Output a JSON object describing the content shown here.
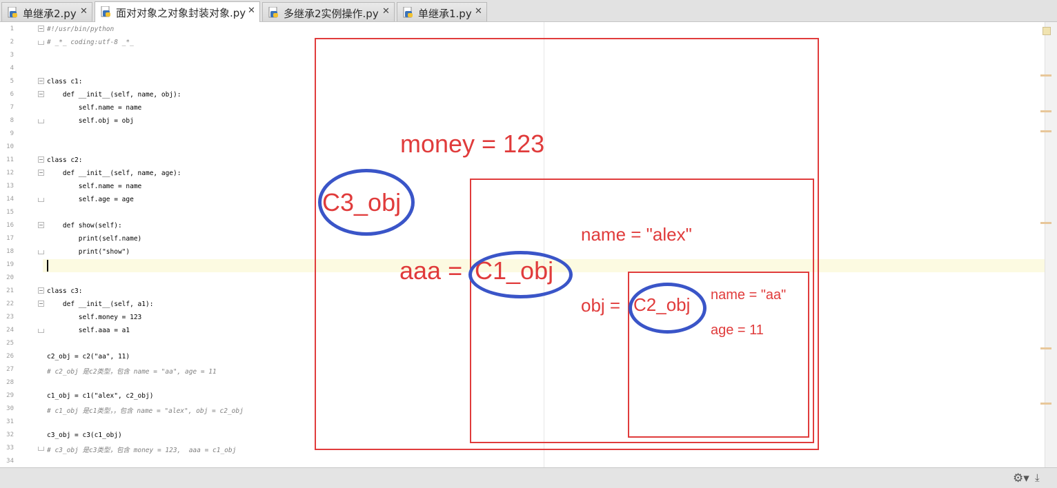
{
  "tabs": [
    {
      "label": "单继承2.py",
      "active": false
    },
    {
      "label": "面对对象之对象封装对象.py",
      "active": true
    },
    {
      "label": "多继承2实例操作.py",
      "active": false
    },
    {
      "label": "单继承1.py",
      "active": false
    }
  ],
  "tab_close_glyph": "✕",
  "line_numbers": [
    "1",
    "2",
    "3",
    "4",
    "5",
    "6",
    "7",
    "8",
    "9",
    "10",
    "11",
    "12",
    "13",
    "14",
    "15",
    "16",
    "17",
    "18",
    "19",
    "20",
    "21",
    "22",
    "23",
    "24",
    "25",
    "26",
    "27",
    "28",
    "29",
    "30",
    "31",
    "32",
    "33",
    "34"
  ],
  "code_lines": [
    "#!/usr/bin/python",
    "# _*_ coding:utf-8 _*_",
    "",
    "",
    "class c1:",
    "    def __init__(self, name, obj):",
    "        self.name = name",
    "        self.obj = obj",
    "",
    "",
    "class c2:",
    "    def __init__(self, name, age):",
    "        self.name = name",
    "        self.age = age",
    "",
    "    def show(self):",
    "        print(self.name)",
    "        print(\"show\")",
    "",
    "",
    "class c3:",
    "    def __init__(self, a1):",
    "        self.money = 123",
    "        self.aaa = a1",
    "",
    "c2_obj = c2(\"aa\", 11)",
    "# c2_obj 是c2类型，包含 name = \"aa\", age = 11",
    "",
    "c1_obj = c1(\"alex\", c2_obj)",
    "# c1_obj 是c1类型，，包含 name = \"alex\", obj = c2_obj",
    "",
    "c3_obj = c3(c1_obj)",
    "# c3_obj 是c3类型，包含 money = 123,  aaa = c1_obj",
    ""
  ],
  "annotations": {
    "money": "money = 123",
    "c3_obj": "C3_obj",
    "aaa": "aaa = ",
    "c1_obj": "C1_obj",
    "name_alex": "name = \"alex\"",
    "obj": "obj = ",
    "c2_obj": "C2_obj",
    "name_aa": "name = \"aa\"",
    "age": "age = 11"
  },
  "colors": {
    "annotation_red": "#e03b3b",
    "annotation_blue": "#3a55c8",
    "current_line": "#fcfae1"
  },
  "status_icons": [
    "gear-icon",
    "download-icon"
  ]
}
